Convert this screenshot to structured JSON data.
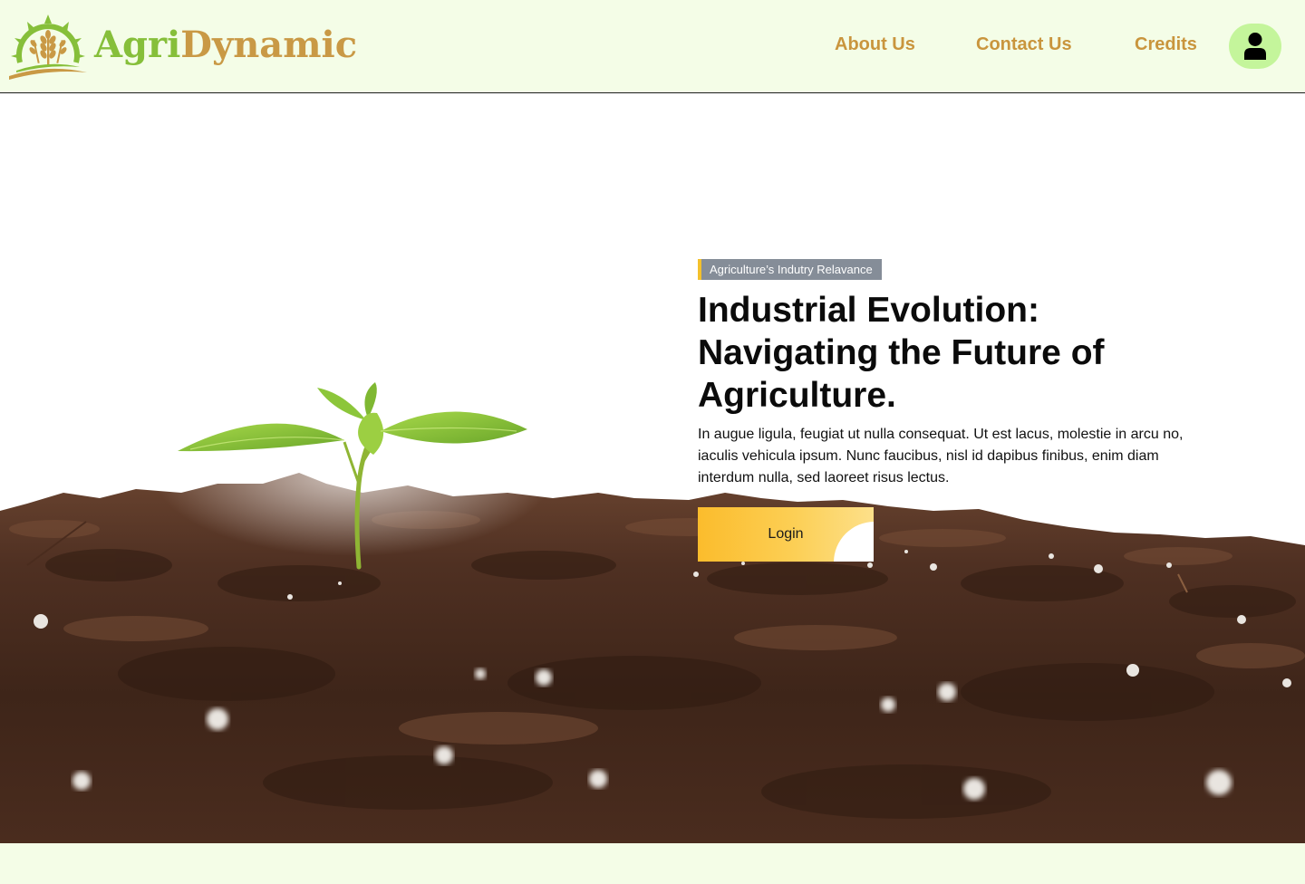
{
  "brand": {
    "name_part1": "Agri",
    "name_part2": "Dynamic",
    "colors": {
      "green": "#86bf3a",
      "gold": "#c99945",
      "header_bg": "#f4fde7"
    }
  },
  "nav": {
    "about": "About Us",
    "contact": "Contact Us",
    "credits": "Credits",
    "account_icon": "user-icon"
  },
  "hero": {
    "badge": "Agriculture’s Indutry Relavance",
    "headline": "Industrial Evolution: Navigating the Future of Agriculture.",
    "paragraph": "In augue ligula, feugiat ut nulla consequat. Ut est lacus, molestie in arcu no, iaculis vehicula ipsum. Nunc faucibus, nisl id dapibus finibus, enim diam interdum nulla, sed laoreet risus lectus.",
    "login_label": "Login",
    "image": "seedling-in-soil"
  }
}
